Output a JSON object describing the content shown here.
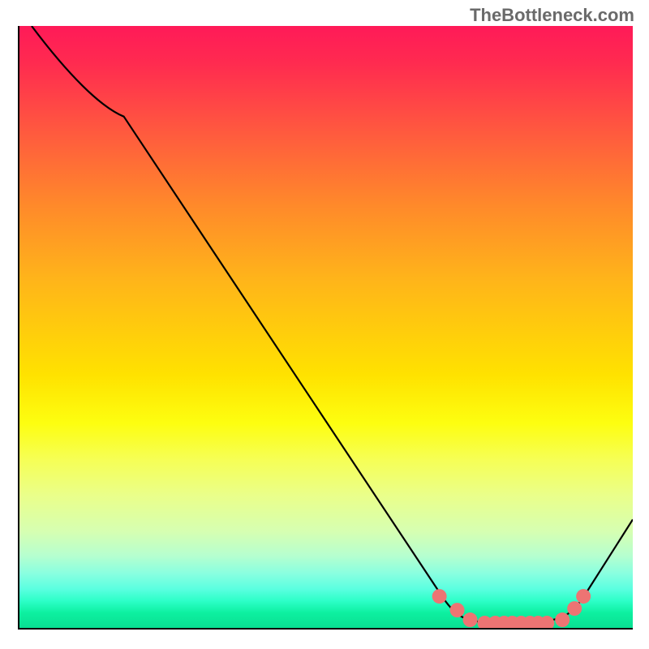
{
  "watermark": "TheBottleneck.com",
  "chart_data": {
    "type": "line",
    "title": "",
    "xlabel": "",
    "ylabel": "",
    "xlim": [
      0,
      100
    ],
    "ylim": [
      0,
      100
    ],
    "series": [
      {
        "name": "curve",
        "points": [
          {
            "x": 2,
            "y": 100
          },
          {
            "x": 17,
            "y": 85
          },
          {
            "x": 69,
            "y": 5
          },
          {
            "x": 73.5,
            "y": 1.3
          },
          {
            "x": 76,
            "y": 0.8
          },
          {
            "x": 86,
            "y": 0.8
          },
          {
            "x": 88.5,
            "y": 1.3
          },
          {
            "x": 92,
            "y": 5
          },
          {
            "x": 100,
            "y": 18
          }
        ]
      }
    ],
    "markers": [
      {
        "x": 68.5,
        "y": 5.2
      },
      {
        "x": 71.4,
        "y": 3.0
      },
      {
        "x": 73.5,
        "y": 1.3
      },
      {
        "x": 75.8,
        "y": 0.8
      },
      {
        "x": 77.6,
        "y": 0.8
      },
      {
        "x": 79.0,
        "y": 0.8
      },
      {
        "x": 80.4,
        "y": 0.8
      },
      {
        "x": 81.8,
        "y": 0.8
      },
      {
        "x": 83.2,
        "y": 0.8
      },
      {
        "x": 84.6,
        "y": 0.8
      },
      {
        "x": 86.0,
        "y": 0.8
      },
      {
        "x": 88.5,
        "y": 1.3
      },
      {
        "x": 90.5,
        "y": 3.2
      },
      {
        "x": 92.0,
        "y": 5.2
      }
    ],
    "gradient_stops": [
      {
        "pos": 0,
        "color": "#ff1a58"
      },
      {
        "pos": 50,
        "color": "#ffe200"
      },
      {
        "pos": 100,
        "color": "#09df92"
      }
    ]
  }
}
